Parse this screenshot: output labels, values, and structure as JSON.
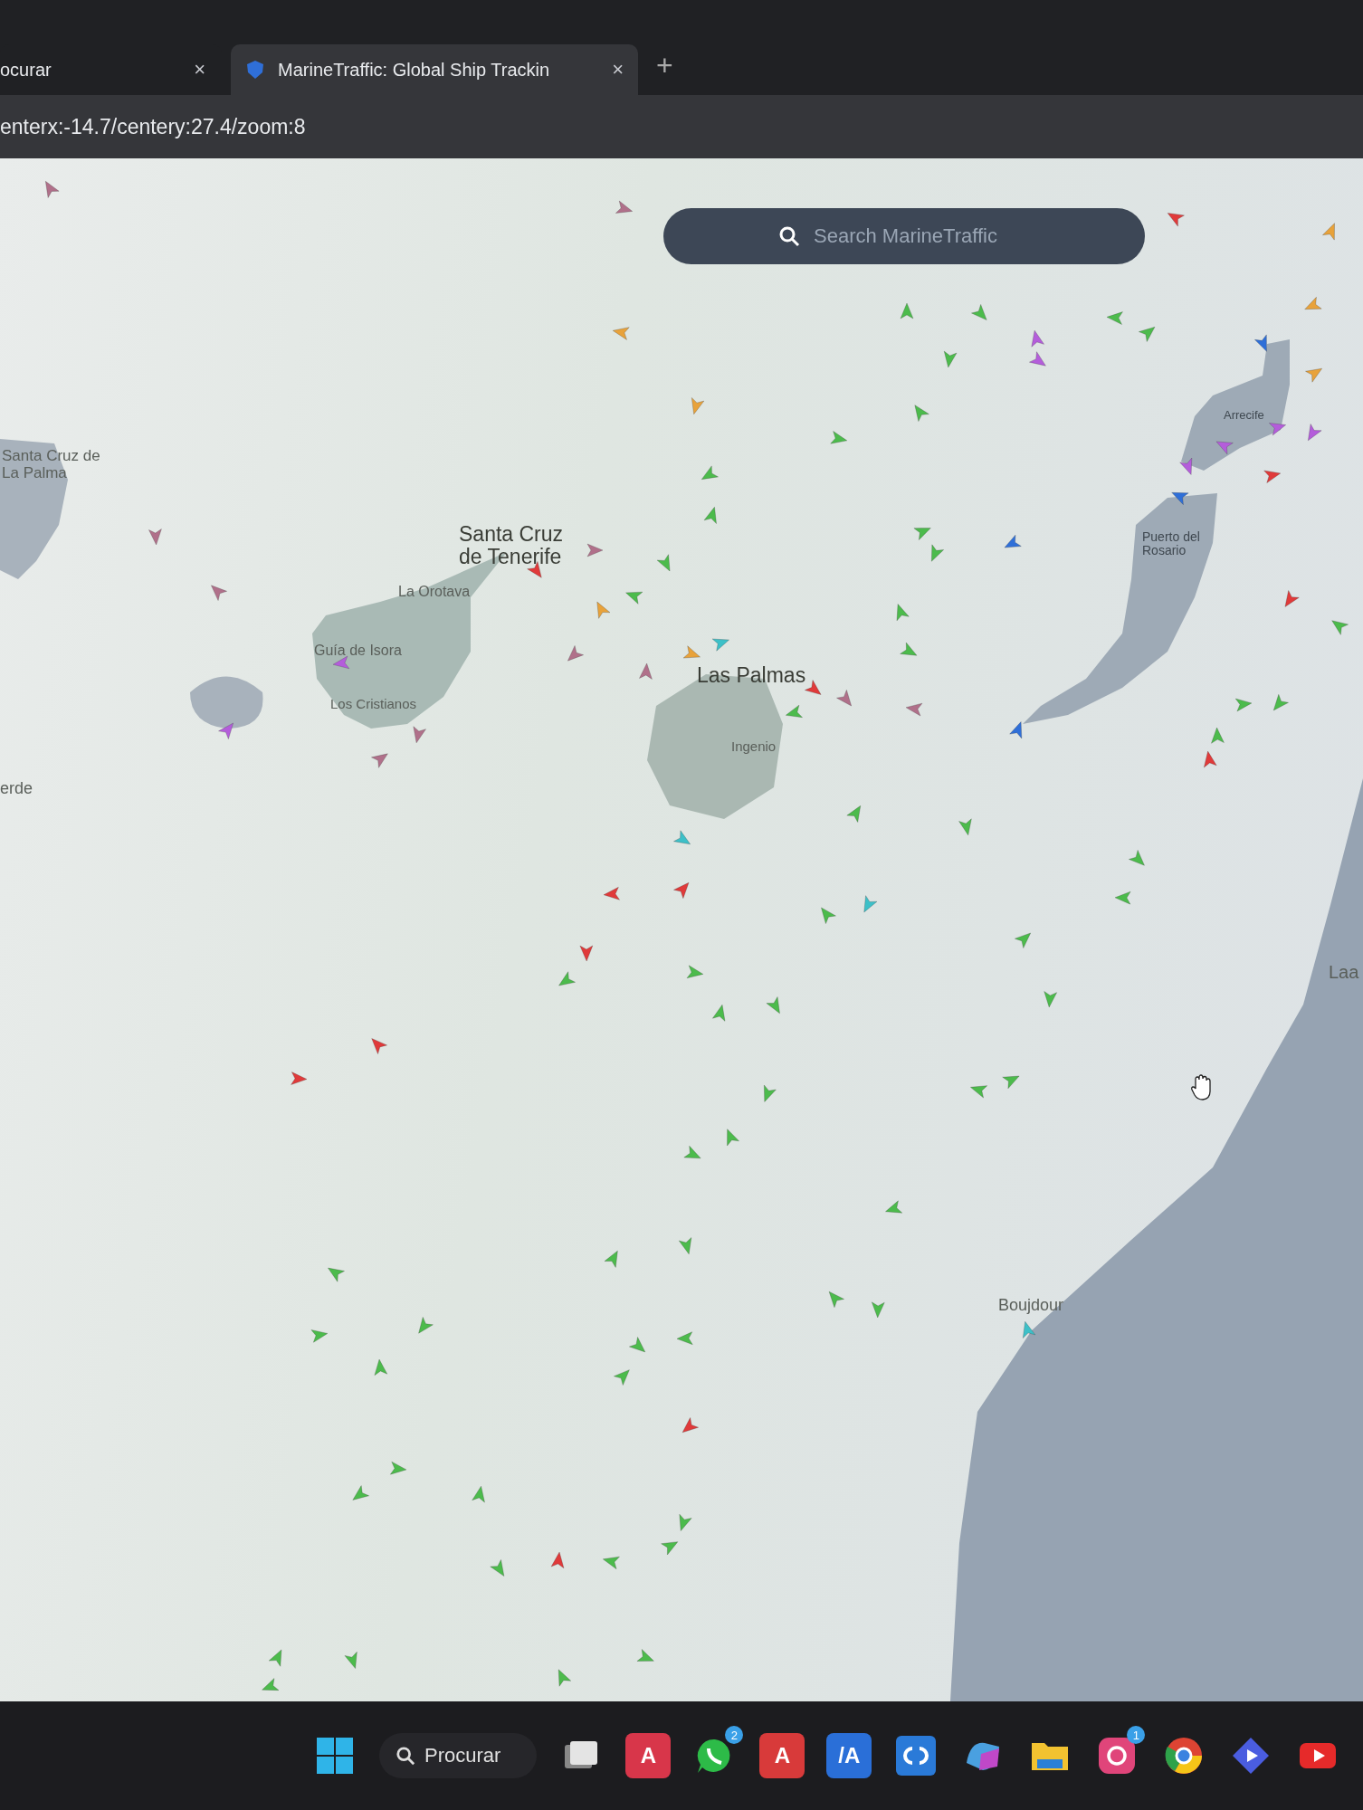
{
  "browser": {
    "tabs": [
      {
        "label": "ocurar",
        "close": "×",
        "selected": false
      },
      {
        "label": "MarineTraffic: Global Ship Trackin",
        "close": "×",
        "selected": true
      }
    ],
    "new_tab": "+",
    "url": "enterx:-14.7/centery:27.4/zoom:8"
  },
  "map": {
    "search": {
      "placeholder": "Search MarineTraffic"
    },
    "places": [
      {
        "name": "Santa Cruz de La Palma",
        "kind": "town"
      },
      {
        "name": "Santa Cruz de Tenerife",
        "kind": "city"
      },
      {
        "name": "La Orotava",
        "kind": "town"
      },
      {
        "name": "Guía de Isora",
        "kind": "town"
      },
      {
        "name": "Los Cristianos",
        "kind": "town"
      },
      {
        "name": "erde",
        "kind": "town"
      },
      {
        "name": "Las Palmas",
        "kind": "city"
      },
      {
        "name": "Ingenio",
        "kind": "town"
      },
      {
        "name": "Arrecife",
        "kind": "small"
      },
      {
        "name": "Puerto del Rosario",
        "kind": "small"
      },
      {
        "name": "Laa",
        "kind": "town"
      },
      {
        "name": "Boujdour",
        "kind": "town"
      }
    ],
    "ships": [
      {
        "color": "#4cbb4c"
      },
      {
        "color": "#4cbb4c"
      },
      {
        "color": "#4cbb4c"
      },
      {
        "color": "#4cbb4c"
      },
      {
        "color": "#4cbb4c"
      },
      {
        "color": "#4cbb4c"
      },
      {
        "color": "#4cbb4c"
      },
      {
        "color": "#4cbb4c"
      },
      {
        "color": "#4cbb4c"
      },
      {
        "color": "#4cbb4c"
      },
      {
        "color": "#4cbb4c"
      },
      {
        "color": "#4cbb4c"
      },
      {
        "color": "#4cbb4c"
      },
      {
        "color": "#4cbb4c"
      },
      {
        "color": "#4cbb4c"
      },
      {
        "color": "#4cbb4c"
      },
      {
        "color": "#4cbb4c"
      },
      {
        "color": "#4cbb4c"
      },
      {
        "color": "#4cbb4c"
      },
      {
        "color": "#4cbb4c"
      },
      {
        "color": "#4cbb4c"
      },
      {
        "color": "#4cbb4c"
      },
      {
        "color": "#4cbb4c"
      },
      {
        "color": "#4cbb4c"
      },
      {
        "color": "#4cbb4c"
      },
      {
        "color": "#4cbb4c"
      },
      {
        "color": "#4cbb4c"
      },
      {
        "color": "#4cbb4c"
      },
      {
        "color": "#4cbb4c"
      },
      {
        "color": "#4cbb4c"
      },
      {
        "color": "#4cbb4c"
      },
      {
        "color": "#4cbb4c"
      },
      {
        "color": "#4cbb4c"
      },
      {
        "color": "#4cbb4c"
      },
      {
        "color": "#4cbb4c"
      },
      {
        "color": "#4cbb4c"
      },
      {
        "color": "#4cbb4c"
      },
      {
        "color": "#4cbb4c"
      },
      {
        "color": "#4cbb4c"
      },
      {
        "color": "#4cbb4c"
      },
      {
        "color": "#4cbb4c"
      },
      {
        "color": "#4cbb4c"
      },
      {
        "color": "#4cbb4c"
      },
      {
        "color": "#4cbb4c"
      },
      {
        "color": "#4cbb4c"
      },
      {
        "color": "#4cbb4c"
      },
      {
        "color": "#4cbb4c"
      },
      {
        "color": "#4cbb4c"
      },
      {
        "color": "#4cbb4c"
      },
      {
        "color": "#4cbb4c"
      },
      {
        "color": "#4cbb4c"
      },
      {
        "color": "#4cbb4c"
      },
      {
        "color": "#4cbb4c"
      },
      {
        "color": "#4cbb4c"
      },
      {
        "color": "#4cbb4c"
      },
      {
        "color": "#4cbb4c"
      },
      {
        "color": "#4cbb4c"
      },
      {
        "color": "#4cbb4c"
      },
      {
        "color": "#4cbb4c"
      },
      {
        "color": "#4cbb4c"
      },
      {
        "color": "#e03a3a"
      },
      {
        "color": "#e03a3a"
      },
      {
        "color": "#e03a3a"
      },
      {
        "color": "#e03a3a"
      },
      {
        "color": "#e03a3a"
      },
      {
        "color": "#e03a3a"
      },
      {
        "color": "#e03a3a"
      },
      {
        "color": "#e03a3a"
      },
      {
        "color": "#e03a3a"
      },
      {
        "color": "#e03a3a"
      },
      {
        "color": "#e03a3a"
      },
      {
        "color": "#e03a3a"
      },
      {
        "color": "#e03a3a"
      },
      {
        "color": "#e8a23a"
      },
      {
        "color": "#e8a23a"
      },
      {
        "color": "#e8a23a"
      },
      {
        "color": "#e8a23a"
      },
      {
        "color": "#e8a23a"
      },
      {
        "color": "#e8a23a"
      },
      {
        "color": "#e8a23a"
      },
      {
        "color": "#b45ddb"
      },
      {
        "color": "#b45ddb"
      },
      {
        "color": "#b45ddb"
      },
      {
        "color": "#b45ddb"
      },
      {
        "color": "#b45ddb"
      },
      {
        "color": "#b45ddb"
      },
      {
        "color": "#b45ddb"
      },
      {
        "color": "#b45ddb"
      },
      {
        "color": "#b0708a"
      },
      {
        "color": "#b0708a"
      },
      {
        "color": "#b0708a"
      },
      {
        "color": "#b0708a"
      },
      {
        "color": "#b0708a"
      },
      {
        "color": "#b0708a"
      },
      {
        "color": "#b0708a"
      },
      {
        "color": "#b0708a"
      },
      {
        "color": "#b0708a"
      },
      {
        "color": "#b0708a"
      },
      {
        "color": "#b0708a"
      },
      {
        "color": "#2f6fd8"
      },
      {
        "color": "#2f6fd8"
      },
      {
        "color": "#2f6fd8"
      },
      {
        "color": "#2f6fd8"
      },
      {
        "color": "#3cc0c8"
      },
      {
        "color": "#3cc0c8"
      },
      {
        "color": "#3cc0c8"
      },
      {
        "color": "#3cc0c8"
      }
    ]
  },
  "taskbar": {
    "search": "Procurar",
    "apps": [
      {
        "kind": "windows"
      },
      {
        "kind": "files"
      },
      {
        "kind": "letter",
        "label": "A",
        "color": "#d8364a"
      },
      {
        "kind": "chat",
        "badge": "2"
      },
      {
        "kind": "letter",
        "label": "A",
        "color": "#d83a3a"
      },
      {
        "kind": "letter",
        "label": "/A",
        "color": "#2a6fd8"
      },
      {
        "kind": "link"
      },
      {
        "kind": "copilot"
      },
      {
        "kind": "folder"
      },
      {
        "kind": "camera",
        "badge": "1"
      },
      {
        "kind": "browser"
      },
      {
        "kind": "diamond"
      },
      {
        "kind": "video"
      }
    ]
  }
}
